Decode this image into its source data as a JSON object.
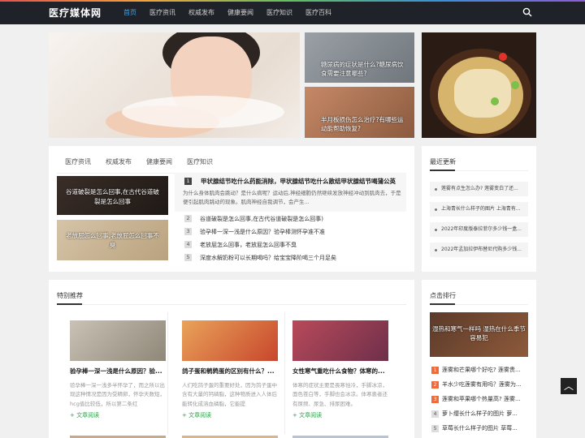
{
  "header": {
    "logo": "医疗媒体网",
    "nav": [
      "首页",
      "医疗资讯",
      "权威发布",
      "健康要闻",
      "医疗知识",
      "医疗百科"
    ],
    "active": "首页"
  },
  "slider": {
    "side": [
      {
        "caption": "糖尿病的症状是什么?糖尿病饮食需要注意哪些?"
      },
      {
        "caption": "半月板损伤怎么治疗?有哪些运动能帮助恢复?"
      }
    ]
  },
  "tabs_panel": {
    "tabs": [
      "医疗资讯",
      "权威发布",
      "健康要闻",
      "医疗知识"
    ],
    "photos": [
      {
        "caption": "谷道破裂是怎么回事,在古代谷道破裂是怎么回事"
      },
      {
        "caption": "老放屁怎么回事,老放屁怎么回事不臭"
      }
    ],
    "headline": {
      "num": "1",
      "title": "甲状腺结节吃什么药能消除，甲状腺结节吃什么散结甲状腺结节喝蒲公英",
      "desc": "为什么身体肌肉会跳动？是什么病呢？运动后,神经细胞仍然继续发放神经冲动到肌肉去，于是便引起肌肉跳动的现象。肌肉神经自我调节，会产生..."
    },
    "list": [
      {
        "num": "2",
        "title": "谷道破裂是怎么回事,在古代谷道破裂是怎么回事)"
      },
      {
        "num": "3",
        "title": "验孕棒一深一浅是什么原因？验孕棒测怀孕准不准"
      },
      {
        "num": "4",
        "title": "老放屁怎么回事，老放屁怎么回事不臭"
      },
      {
        "num": "5",
        "title": "深度水解奶粉可以长期喝吗？给宝宝降阶喝三个月足矣"
      }
    ]
  },
  "updates": {
    "title": "最近更新",
    "items": [
      "莲雾有点生怎么办? 莲雾变白了还...",
      "上海青长什么样子的图片 上海青有...",
      "2022年印度版泰拉菲尔多少钱一盒...",
      "2022年孟加拉伊布替尼代购多少钱..."
    ]
  },
  "featured": {
    "title": "特别推荐",
    "cards": [
      {
        "title": "验孕棒一深一浅是什么原因？验...",
        "desc": "验孕棒一深一浅多半怀孕了，而之所以出现这种情况是因为受精卵，怀孕天数短，hcg值比较低，所以第二条红",
        "more": "+ 文章阅读"
      },
      {
        "title": "鸽子蛋和鹌鹑蛋的区别有什么？...",
        "desc": "人们吃鸽子蛋的重要好处，因为鸽子蛋中含有大量的钙磷脂，这种物质进入人体后能转化成溶血磷脂，它能提",
        "more": "+ 文章阅读"
      },
      {
        "title": "女性寒气重吃什么食物？体寒的...",
        "desc": "体寒的症状主要是畏寒怕冷，手脚冰凉，面色苍白等，手脚也会冰凉。体寒患者还有尿频、尿急、排尿困难。",
        "more": "+ 文章阅读"
      }
    ]
  },
  "ranking": {
    "title": "点击排行",
    "image_caption": "湿热和寒气一样吗 湿热在什么季节容易犯",
    "items": [
      {
        "num": "1",
        "title": "莲雾和芒果哪个好吃? 莲雾贵..."
      },
      {
        "num": "2",
        "title": "羊水少吃莲雾有用吗？莲雾为..."
      },
      {
        "num": "3",
        "title": "莲雾和苹果哪个热量高? 莲雾..."
      },
      {
        "num": "4",
        "title": "萝卜缨长什么样子的图片 萝..."
      },
      {
        "num": "5",
        "title": "草莓长什么样子的图片 草莓..."
      }
    ]
  },
  "totop": "︿"
}
